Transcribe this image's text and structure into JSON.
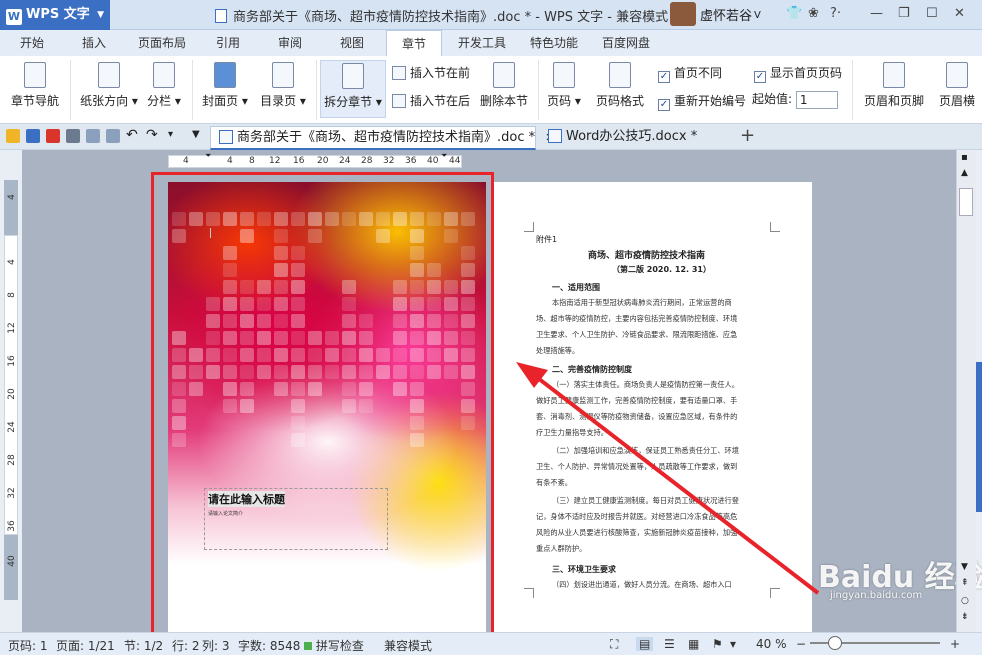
{
  "app": {
    "name": "WPS 文字",
    "logo_letter": "W",
    "window_title": "商务部关于《商场、超市疫情防控技术指南》.doc * - WPS 文字 - 兼容模式",
    "user": "虚怀若谷"
  },
  "menu_tabs": [
    "开始",
    "插入",
    "页面布局",
    "引用",
    "审阅",
    "视图",
    "章节",
    "开发工具",
    "特色功能",
    "百度网盘"
  ],
  "active_tab": "章节",
  "ribbon": {
    "section_nav": "章节导航",
    "paper_direction": "纸张方向",
    "columns": "分栏",
    "cover_page": "封面页",
    "toc_page": "目录页",
    "split_section": "拆分章节",
    "insert_before": "插入节在前",
    "insert_after": "插入节在后",
    "delete_section": "删除本节",
    "page_number": "页码",
    "page_number_format": "页码格式",
    "first_page_different": "首页不同",
    "restart_numbering": "重新开始编号",
    "show_first_page_number": "显示首页页码",
    "start_value_label": "起始值:",
    "start_value": "1",
    "header_footer": "页眉和页脚",
    "header_more": "页眉横"
  },
  "doc_tabs": [
    {
      "label": "商务部关于《商场、超市疫情防控技术指南》.doc *",
      "active": true
    },
    {
      "label": "Word办公技巧.docx *",
      "active": false
    }
  ],
  "ruler_h": [
    "4",
    "4",
    "8",
    "12",
    "16",
    "20",
    "24",
    "28",
    "32",
    "36",
    "40",
    "44"
  ],
  "ruler_v": [
    "4",
    "4",
    "8",
    "12",
    "16",
    "20",
    "24",
    "28",
    "32",
    "36",
    "40"
  ],
  "cover": {
    "title_placeholder": "请在此输入标题",
    "subtitle_placeholder": "请输入论文简介"
  },
  "page2": {
    "attachment": "附件1",
    "title": "商场、超市疫情防控技术指南",
    "edition": "（第二版 2020. 12. 31）",
    "h1": "一、适用范围",
    "p1": [
      "本指南适用于新型冠状病毒肺炎流行期间，正常运营的商",
      "场、超市等的疫情防控，主要内容包括完善疫情防控制度、环境",
      "卫生要求、个人卫生防护、冷链食品要求、限流限距措施、应急",
      "处理措施等。"
    ],
    "h2": "二、完善疫情防控制度",
    "p2": [
      "（一）落实主体责任。商场负责人是疫情防控第一责任人。",
      "做好员工健康监测工作，完善疫情防控制度，要有适量口罩、手",
      "套、消毒剂、测温仪等防疫物资储备，设置应急区域，有条件的",
      "疗卫生力量指导支持。"
    ],
    "p3": [
      "（二）加强培训和应急演练，保证员工熟悉责任分工、环境",
      "卫生、个人防护、异常情况处置等，人员疏散等工作要求，做到",
      "有条不紊。"
    ],
    "p4": [
      "（三）建立员工健康监测制度。每日对员工健康状况进行登",
      "记，身体不适时应及时报告并就医。对经营进口冷冻食品等高危",
      "风险的从业人员要进行核酸筛查，实施新冠肺炎疫苗接种，加强",
      "重点人群防护。"
    ],
    "h3": "三、环境卫生要求",
    "p5": "（四）划设进出通道，做好人员分流。在商场、超市入口"
  },
  "status": {
    "page_num": "页码: 1",
    "page_total": "页面: 1/21",
    "section": "节: 1/2",
    "row": "行: 2",
    "col": "列: 3",
    "word_count": "字数: 8548",
    "spellcheck": "拼写检查",
    "compat_mode": "兼容模式",
    "zoom": "40 %"
  },
  "watermark": {
    "logo": "Baidu 经验",
    "url": "jingyan.baidu.com"
  },
  "colors": {
    "accent": "#3a6fc4",
    "highlight_box": "#e8232a",
    "arrow": "#e8232a"
  }
}
